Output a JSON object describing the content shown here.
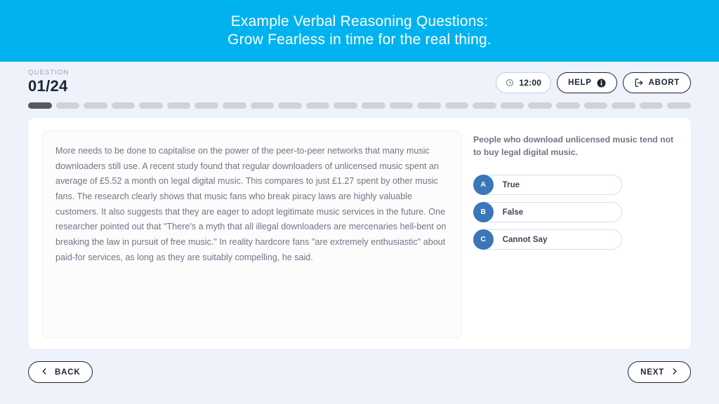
{
  "banner": {
    "line1": "Example Verbal Reasoning Questions:",
    "line2": "Grow Fearless in time for the real thing.",
    "background_color": "#00b3ef",
    "text_color": "#ffffff"
  },
  "topbar": {
    "question_label": "QUESTION",
    "question_value": "01/24",
    "timer": {
      "value": "12:00",
      "icon": "clock-icon",
      "border_color": "#b8d4ef"
    },
    "help": {
      "label": "HELP",
      "icon": "info-icon"
    },
    "abort": {
      "label": "ABORT",
      "icon": "exit-icon"
    }
  },
  "progress": {
    "total": 24,
    "current": 1,
    "active_color": "#58595e",
    "inactive_color": "#cfd2d6"
  },
  "passage": {
    "text": "More needs to be done to capitalise on the power of the peer-to-peer networks that many music downloaders still use. A recent study found that regular downloaders of unlicensed music spent an average of £5.52 a month on legal digital music. This compares to just £1.27 spent by other music fans. The research clearly shows that music fans who break piracy laws are highly valuable customers. It also suggests that they are eager to adopt legitimate music services in the future. One researcher pointed out that \"There's a myth that all illegal downloaders are mercenaries hell-bent on breaking the law in pursuit of free music.\" In reality hardcore fans \"are extremely enthusiastic\" about paid-for services, as long as they are suitably compelling, he said."
  },
  "question": {
    "stem": "People who download unlicensed music tend not to buy legal digital music.",
    "badge_color": "#3a76b8",
    "options": [
      {
        "key": "A",
        "label": "True"
      },
      {
        "key": "B",
        "label": "False"
      },
      {
        "key": "C",
        "label": "Cannot Say"
      }
    ]
  },
  "footer": {
    "back_label": "BACK",
    "next_label": "NEXT"
  }
}
